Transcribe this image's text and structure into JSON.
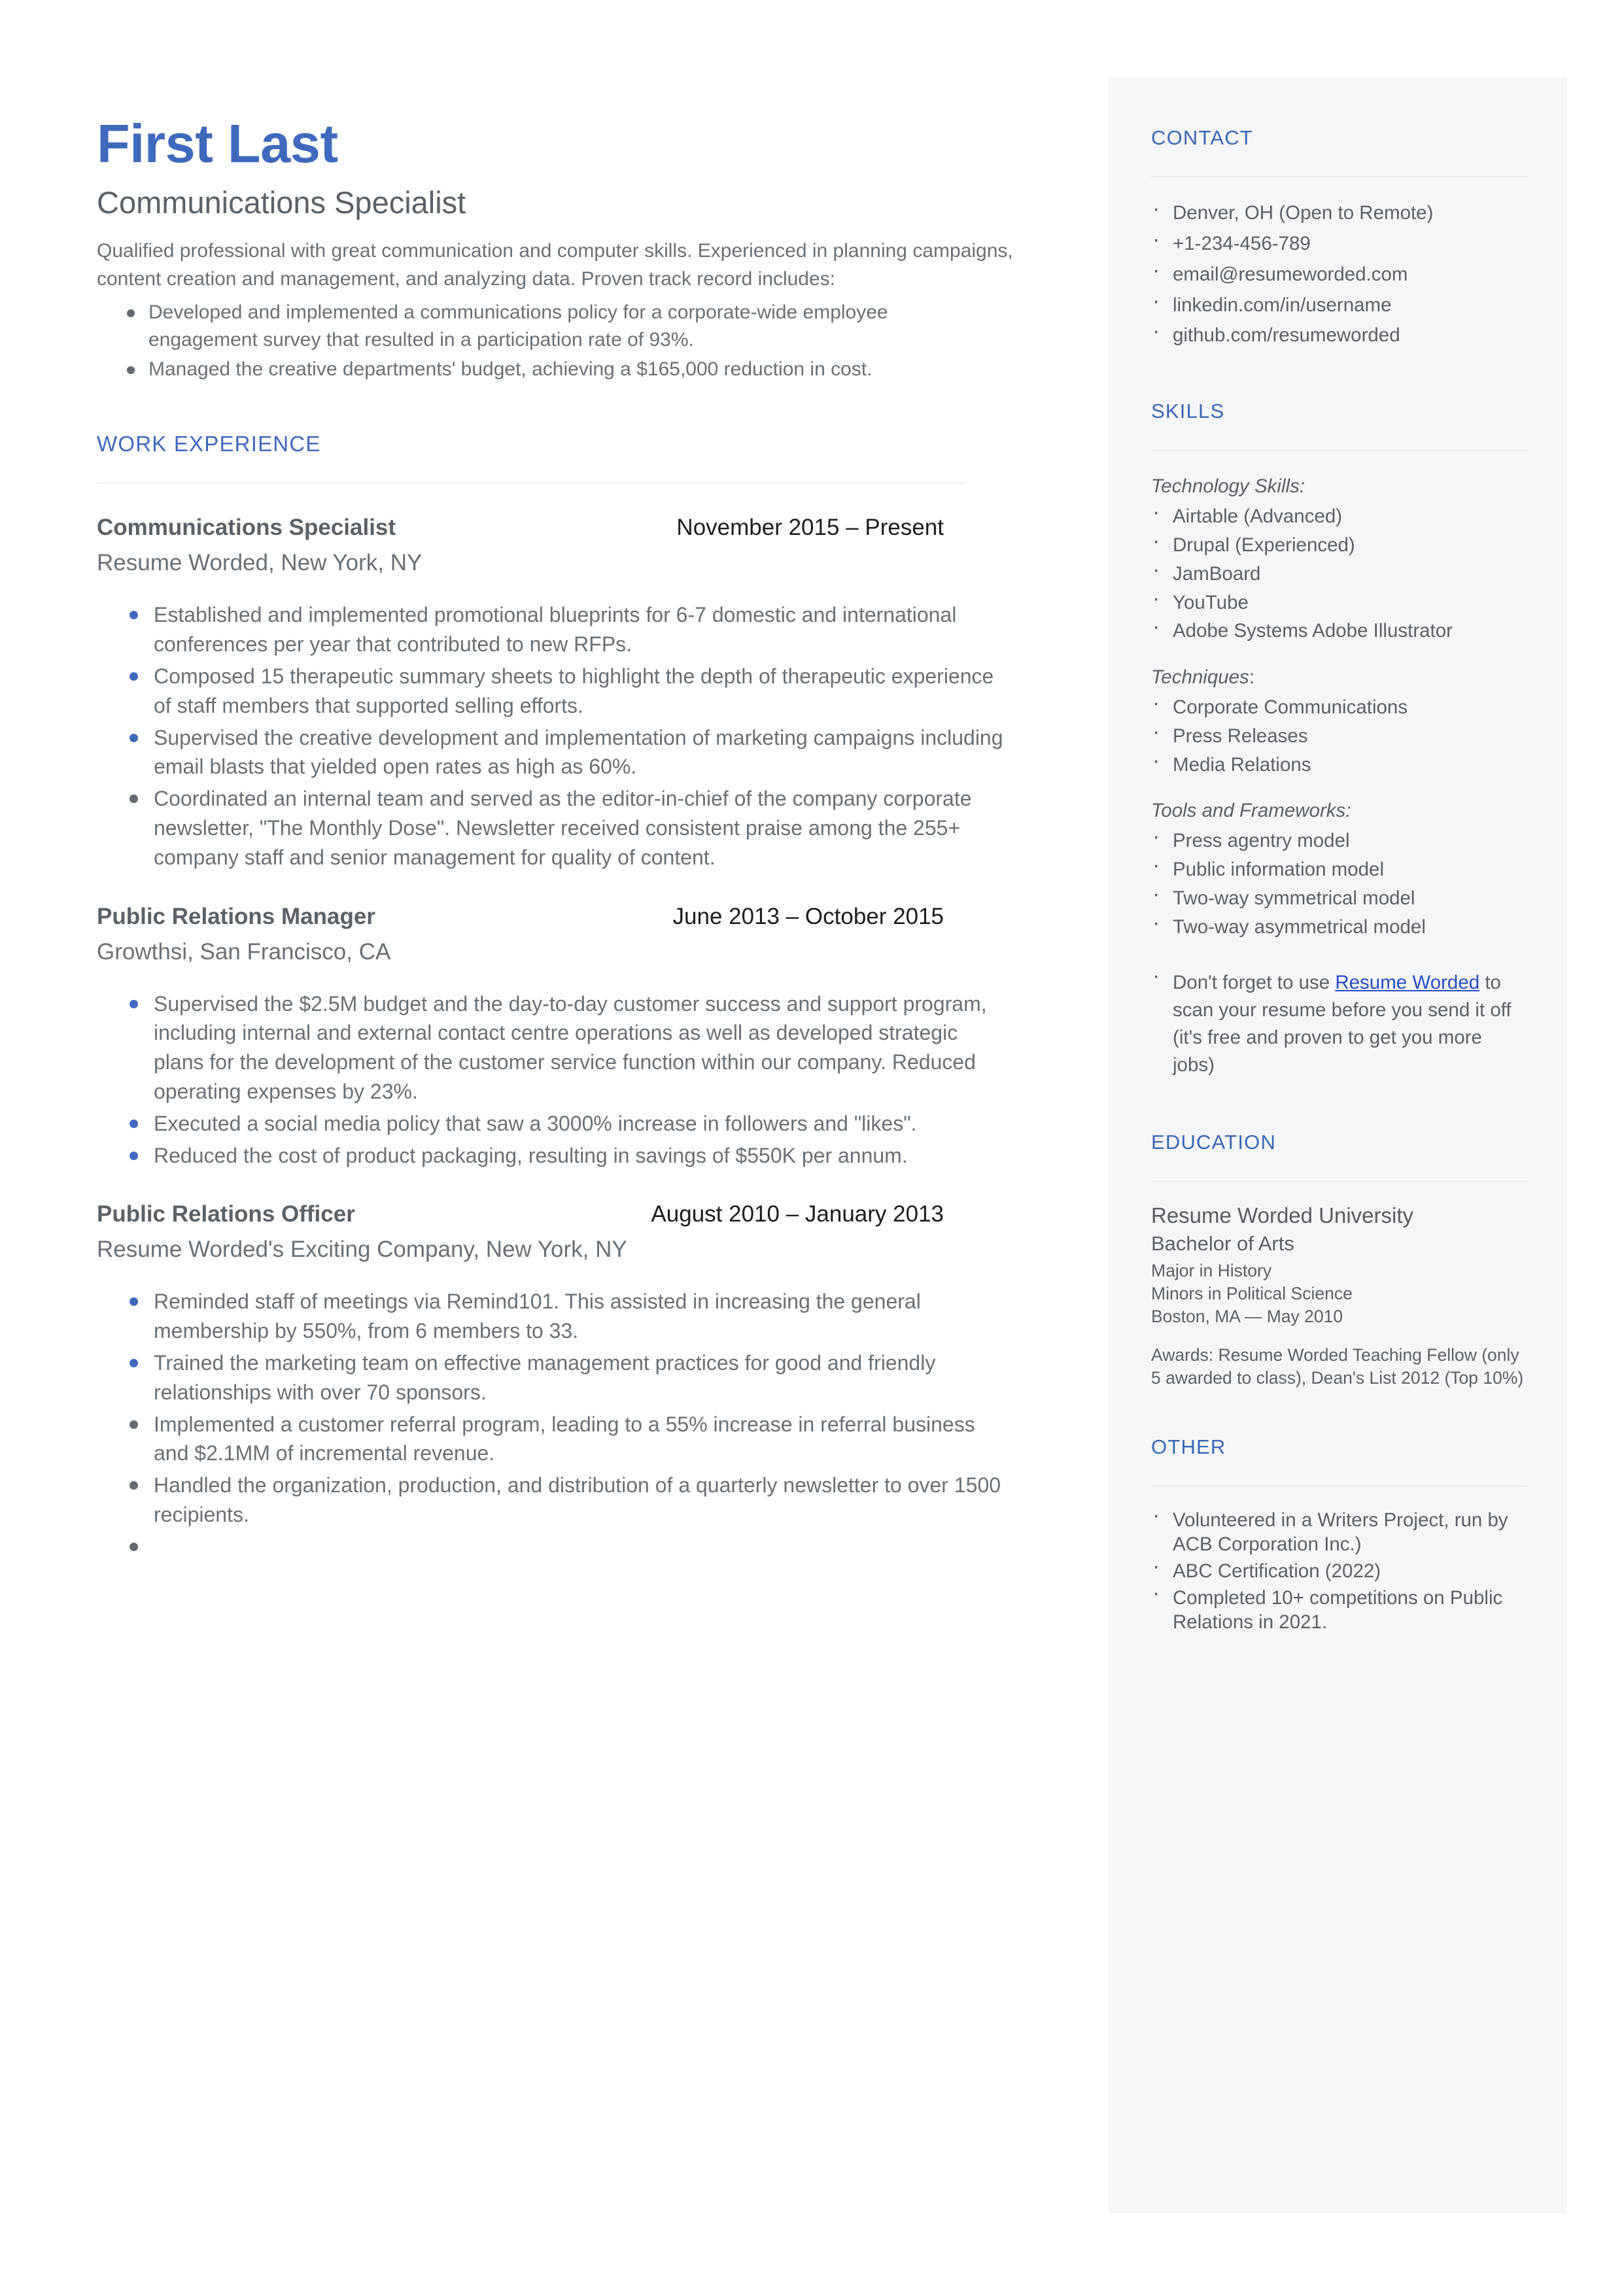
{
  "colors": {
    "accent_blue": "#3f69bd",
    "heading_blue": "#3a66b7",
    "link_blue": "#2a4fc4",
    "body_gray": "#6a7075",
    "sidebar_bg": "#f4f6f8",
    "rule_gray": "#dcdfe2",
    "bullet_blue": "#3f69bd",
    "bullet_gray": "#646a6f"
  },
  "header": {
    "name": "First Last",
    "job_title": "Communications Specialist",
    "summary": "Qualified professional with great communication and computer skills. Experienced in planning campaigns, content creation and management, and analyzing data. Proven track record includes:",
    "summary_bullets": [
      "Developed and implemented a communications policy for a corporate-wide employee engagement survey that resulted in a participation rate of 93%.",
      "Managed the creative departments' budget, achieving a $165,000 reduction in cost."
    ]
  },
  "work_experience": {
    "heading": "WORK EXPERIENCE",
    "jobs": [
      {
        "role": "Communications Specialist",
        "dates": "November 2015 – Present",
        "company": "Resume Worded, New York, NY",
        "bullets": [
          {
            "text": "Established and implemented promotional blueprints for 6-7 domestic and international conferences per year that contributed to new RFPs.",
            "bullet_color": "blue"
          },
          {
            "text": "Composed 15 therapeutic summary sheets to highlight the depth of therapeutic experience of staff members that supported selling efforts.",
            "bullet_color": "blue"
          },
          {
            "text": "Supervised the creative development and implementation of marketing campaigns including email blasts that yielded open rates as high as 60%.",
            "bullet_color": "blue"
          },
          {
            "text": "Coordinated an internal team and served as the editor-in-chief of the company corporate newsletter, \"The Monthly Dose\". Newsletter received consistent praise among the 255+ company staff and senior management for quality of content.",
            "bullet_color": "gray"
          }
        ]
      },
      {
        "role": "Public Relations Manager",
        "dates": "June 2013 – October 2015",
        "company": "Growthsi, San Francisco, CA",
        "bullets": [
          {
            "text": "Supervised the $2.5M budget and the day-to-day customer success and support program, including internal and external contact centre operations as well as developed strategic plans for the development of the customer service function within our company. Reduced operating expenses by 23%.",
            "bullet_color": "blue"
          },
          {
            "text": "Executed a social media policy that saw a 3000% increase in followers and \"likes\".",
            "bullet_color": "blue"
          },
          {
            "text": "Reduced the cost of product packaging, resulting in savings of $550K per annum.",
            "bullet_color": "blue"
          }
        ]
      },
      {
        "role": "Public Relations Officer",
        "dates": "August 2010 – January 2013",
        "company": "Resume Worded's Exciting Company, New York, NY",
        "bullets": [
          {
            "text": "Reminded staff of meetings via Remind101. This assisted in increasing the general membership by 550%, from 6 members to 33.",
            "bullet_color": "blue"
          },
          {
            "text": "Trained the marketing team on effective management practices for good and friendly relationships with over 70 sponsors.",
            "bullet_color": "blue"
          },
          {
            "text": "Implemented a customer referral program, leading to a 55% increase in referral business and $2.1MM of incremental revenue.",
            "bullet_color": "gray"
          },
          {
            "text": "Handled the organization, production, and distribution of a quarterly newsletter to over 1500 recipients.",
            "bullet_color": "gray"
          },
          {
            "text": "",
            "bullet_color": "gray"
          }
        ]
      }
    ]
  },
  "sidebar": {
    "contact": {
      "heading": "CONTACT",
      "items": [
        "Denver, OH (Open to Remote)",
        "+1-234-456-789",
        "email@resumeworded.com",
        "linkedin.com/in/username",
        "github.com/resumeworded"
      ]
    },
    "skills": {
      "heading": "SKILLS",
      "groups": [
        {
          "label": "Technology Skills:",
          "label_colon_plain": false,
          "items": [
            "Airtable (Advanced)",
            "Drupal (Experienced)",
            "JamBoard",
            "YouTube",
            "Adobe Systems Adobe Illustrator"
          ]
        },
        {
          "label": "Techniques",
          "label_colon_plain": true,
          "items": [
            "Corporate Communications",
            "Press Releases",
            "Media Relations"
          ]
        },
        {
          "label": "Tools and Frameworks:",
          "label_colon_plain": false,
          "items": [
            "Press agentry model",
            "Public information model",
            "Two-way symmetrical model",
            "Two-way asymmetrical model"
          ]
        }
      ],
      "promo": {
        "before": "Don't forget to use ",
        "link": "Resume Worded",
        "after": " to scan your resume before you send it off (it's free and proven to get you more jobs)"
      }
    },
    "education": {
      "heading": "EDUCATION",
      "school": "Resume Worded University",
      "degree": "Bachelor of Arts",
      "major": "Major in History",
      "minors": "Minors in Political Science",
      "location_date": "Boston, MA — May 2010",
      "awards": "Awards: Resume Worded Teaching Fellow (only 5 awarded to class), Dean's List 2012 (Top 10%)"
    },
    "other": {
      "heading": "OTHER",
      "items": [
        "Volunteered in a Writers Project, run by ACB Corporation Inc.)",
        "ABC Certification (2022)",
        "Completed 10+ competitions on Public Relations in 2021."
      ]
    }
  }
}
